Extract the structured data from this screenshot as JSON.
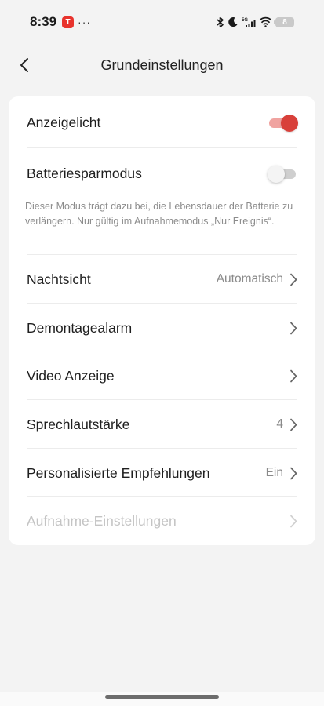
{
  "status_bar": {
    "time": "8:39",
    "app_badge": "T",
    "dots": "···",
    "network": "5G",
    "battery_level": "8"
  },
  "header": {
    "title": "Grundeinstellungen"
  },
  "settings": {
    "indicator_light": {
      "label": "Anzeigelicht",
      "enabled": true
    },
    "battery_saver": {
      "label": "Batteriesparmodus",
      "enabled": false,
      "description": "Dieser Modus trägt dazu bei, die Lebensdauer der Batterie zu verlängern. Nur gültig im Aufnahmemodus „Nur Ereignis“."
    },
    "night_vision": {
      "label": "Nachtsicht",
      "value": "Automatisch"
    },
    "tamper_alarm": {
      "label": "Demontagealarm"
    },
    "video_display": {
      "label": "Video Anzeige"
    },
    "speaker_volume": {
      "label": "Sprechlautstärke",
      "value": "4"
    },
    "recommendations": {
      "label": "Personalisierte Empfehlungen",
      "value": "Ein"
    },
    "recording_settings": {
      "label": "Aufnahme-Einstellungen",
      "disabled": true
    }
  },
  "colors": {
    "accent": "#d8403a",
    "background": "#f3f3f3",
    "card": "#ffffff",
    "muted_text": "#8a8a8a",
    "disabled_text": "#c4c4c4"
  }
}
